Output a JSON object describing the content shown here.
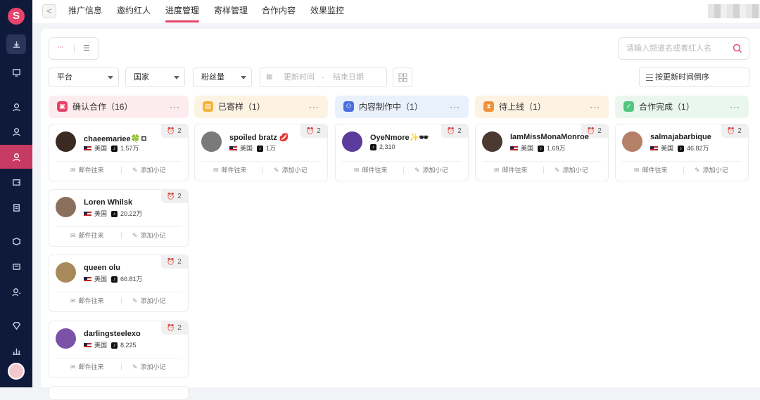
{
  "brand": {
    "logo_glyph": "S",
    "accent": "#e8436a",
    "sidebar_bg": "#0f1a3a"
  },
  "sidebar": {
    "items": [
      {
        "icon": "download-icon"
      },
      {
        "icon": "monitor-icon"
      },
      {
        "icon": "user-icon"
      },
      {
        "icon": "user-icon"
      },
      {
        "icon": "user-active-icon",
        "active": true
      },
      {
        "icon": "wallet-icon"
      },
      {
        "icon": "report-icon"
      },
      {
        "icon": "box-icon"
      },
      {
        "icon": "tag-icon"
      },
      {
        "icon": "person-settings-icon"
      },
      {
        "icon": "diamond-icon"
      },
      {
        "icon": "bar-chart-icon"
      }
    ]
  },
  "topbar": {
    "back": "<",
    "tabs": [
      "推广信息",
      "邀约红人",
      "进度管理",
      "寄样管理",
      "合作内容",
      "效果监控"
    ],
    "active_tab": "进度管理"
  },
  "toolbar": {
    "search_placeholder": "请输入频道名或者红人名",
    "filters": [
      "平台",
      "国家",
      "粉丝量"
    ],
    "date_start": "更新时间",
    "date_sep": "-",
    "date_end": "结束日期",
    "sort_label": "按更新时间倒序"
  },
  "columns": [
    {
      "title": "确认合作",
      "count": "（16）",
      "more": "···",
      "bg": "#fdecef",
      "icon_bg": "#e8436a",
      "icon": "handshake-icon"
    },
    {
      "title": "已寄样",
      "count": "（1）",
      "more": "···",
      "bg": "#fdf3e3",
      "icon_bg": "#f4b43c",
      "icon": "package-icon"
    },
    {
      "title": "内容制作中",
      "count": "（1）",
      "more": "···",
      "bg": "#e9f1fd",
      "icon_bg": "#4b6fe0",
      "icon": "people-icon"
    },
    {
      "title": "待上线",
      "count": "（1）",
      "more": "···",
      "bg": "#fdf3e3",
      "icon_bg": "#f0923a",
      "icon": "hourglass-icon"
    },
    {
      "title": "合作完成",
      "count": "（1）",
      "more": "···",
      "bg": "#eaf7ef",
      "icon_bg": "#55c680",
      "icon": "check-icon"
    }
  ],
  "cards": [
    {
      "name": "chaeemariee🍀ㅁ",
      "country": "美国",
      "followers": "1.57万",
      "alarm": "2",
      "avatar": "#3a2a22"
    },
    {
      "name": "spoiled bratz 💋",
      "country": "美国",
      "followers": "1万",
      "alarm": "2",
      "avatar": "#7a7a7a"
    },
    {
      "name": "OyeNmore✨🕶",
      "country": "",
      "followers": "2,310",
      "alarm": "2",
      "avatar": "#5b3b9c"
    },
    {
      "name": "IamMissMonaMonroe",
      "country": "美国",
      "followers": "1.69万",
      "alarm": "2",
      "avatar": "#4a3a32"
    },
    {
      "name": "salmajabarbique",
      "country": "美国",
      "followers": "46.82万",
      "alarm": "2",
      "avatar": "#b48068"
    },
    {
      "name": "Loren Whilsk",
      "country": "美国",
      "followers": "20.22万",
      "alarm": "2",
      "avatar": "#8a6f5c"
    },
    {
      "name": "queen olu",
      "country": "美国",
      "followers": "66.81万",
      "alarm": "2",
      "avatar": "#a88a5a"
    },
    {
      "name": "darlingsteelexo",
      "country": "美国",
      "followers": "8,225",
      "alarm": "2",
      "avatar": "#7c52a8"
    }
  ],
  "card_actions": {
    "mail": "邮件往来",
    "note": "添加小记"
  }
}
